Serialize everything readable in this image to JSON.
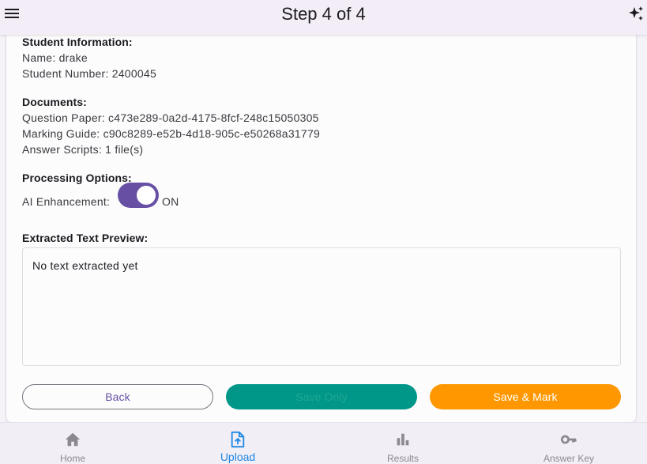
{
  "appbar": {
    "title": "Step 4 of 4",
    "menu_icon": "menu-icon",
    "action_icon": "sparkles-icon"
  },
  "student": {
    "section_title": "Student Information:",
    "name_line": "Name: drake",
    "number_line": "Student Number: 2400045"
  },
  "documents": {
    "section_title": "Documents:",
    "question_paper_line": "Question Paper: c473e289-0a2d-4175-8fcf-248c15050305",
    "marking_guide_line": "Marking Guide: c90c8289-e52b-4d18-905c-e50268a31779",
    "answer_scripts_line": "Answer Scripts: 1 file(s)"
  },
  "processing": {
    "section_title": "Processing Options:",
    "ai_label": "AI Enhancement:",
    "ai_state": "ON",
    "ai_enabled": true
  },
  "preview": {
    "section_title": "Extracted Text Preview:",
    "text": "No text extracted yet"
  },
  "actions": {
    "back_label": "Back",
    "save_only_label": "Save Only",
    "save_mark_label": "Save & Mark"
  },
  "bottom_nav": {
    "items": [
      {
        "label": "Home",
        "icon": "home-icon",
        "active": false
      },
      {
        "label": "Upload",
        "icon": "upload-file-icon",
        "active": true
      },
      {
        "label": "Results",
        "icon": "bar-chart-icon",
        "active": false
      },
      {
        "label": "Answer Key",
        "icon": "key-icon",
        "active": false
      }
    ]
  },
  "colors": {
    "primary": "#6750a4",
    "save_only": "#009688",
    "save_mark": "#ff9800",
    "nav_active": "#1e88e5",
    "nav_inactive": "#8b8890"
  }
}
